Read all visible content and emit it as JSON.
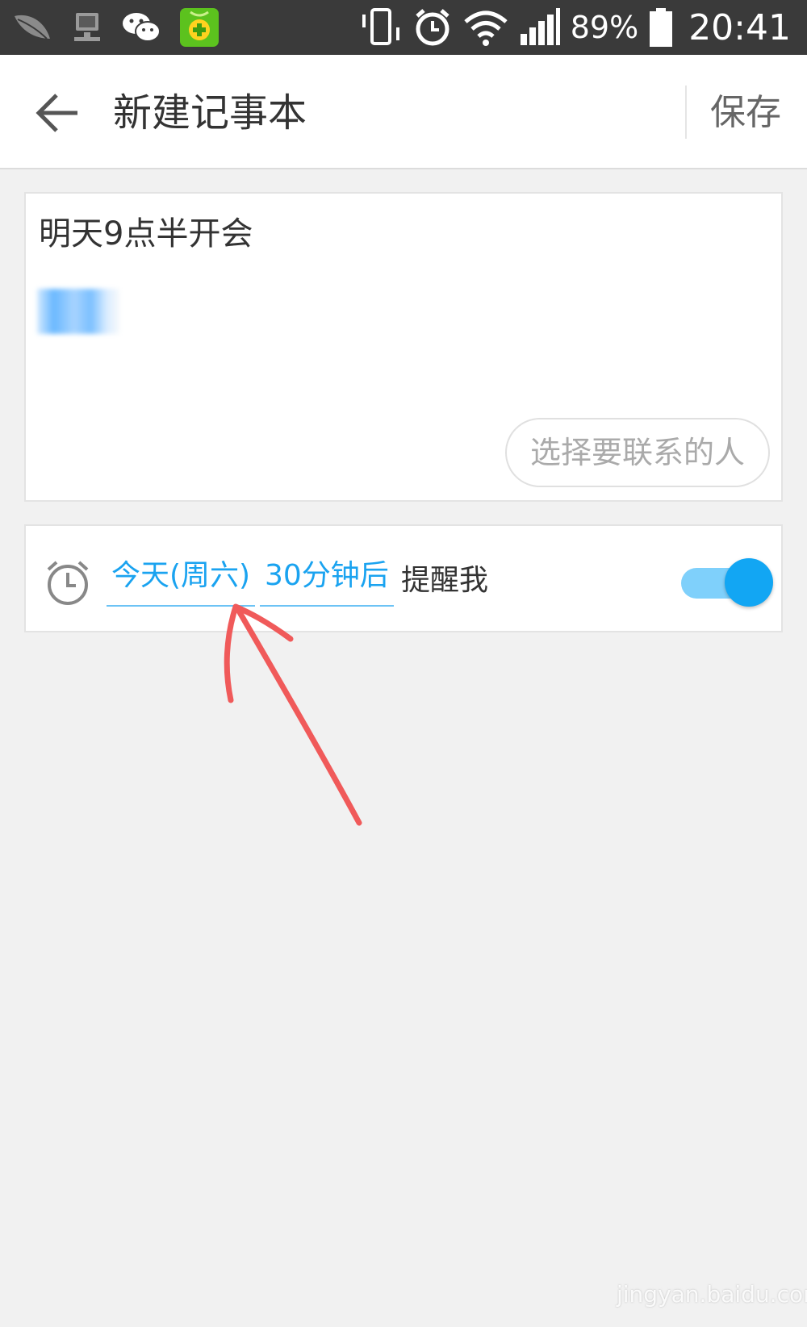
{
  "status_bar": {
    "battery": "89%",
    "time": "20:41",
    "icons": [
      "leaf-icon",
      "pc-sync-icon",
      "wechat-icon",
      "app-360-icon",
      "vibrate-icon",
      "alarm-icon",
      "wifi-icon",
      "signal-icon",
      "battery-icon"
    ]
  },
  "header": {
    "title": "新建记事本",
    "save_label": "保存"
  },
  "note": {
    "title": "明天9点半开会",
    "contact_button": "选择要联系的人"
  },
  "reminder": {
    "date": "今天(周六)",
    "time": "30分钟后",
    "suffix": "提醒我",
    "enabled": true
  },
  "watermark": "jingyan.baidu.com",
  "colors": {
    "accent": "#12a6f3",
    "annotation": "#f05a5a",
    "status_bar_bg": "#3a3a3a"
  }
}
